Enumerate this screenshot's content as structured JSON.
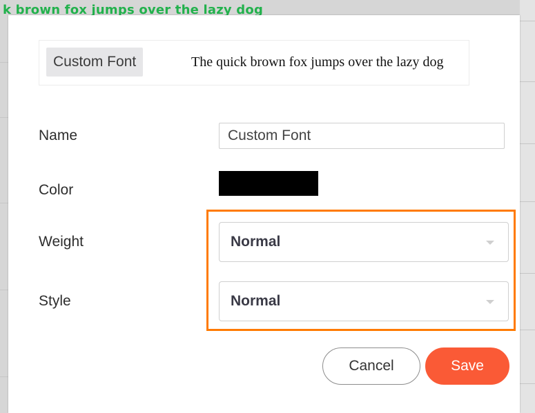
{
  "background": {
    "green_text": "k brown fox jumps over the lazy dog"
  },
  "preview": {
    "tag_label": "Custom Font",
    "sample_text": "The quick brown fox jumps over the lazy dog"
  },
  "form": {
    "name_label": "Name",
    "name_value": "Custom Font",
    "color_label": "Color",
    "color_value": "#000000",
    "weight_label": "Weight",
    "weight_value": "Normal",
    "style_label": "Style",
    "style_value": "Normal"
  },
  "actions": {
    "cancel_label": "Cancel",
    "save_label": "Save"
  },
  "colors": {
    "highlight": "#ff7a00",
    "save_button": "#fa5a36",
    "background_text": "#22b14c"
  }
}
